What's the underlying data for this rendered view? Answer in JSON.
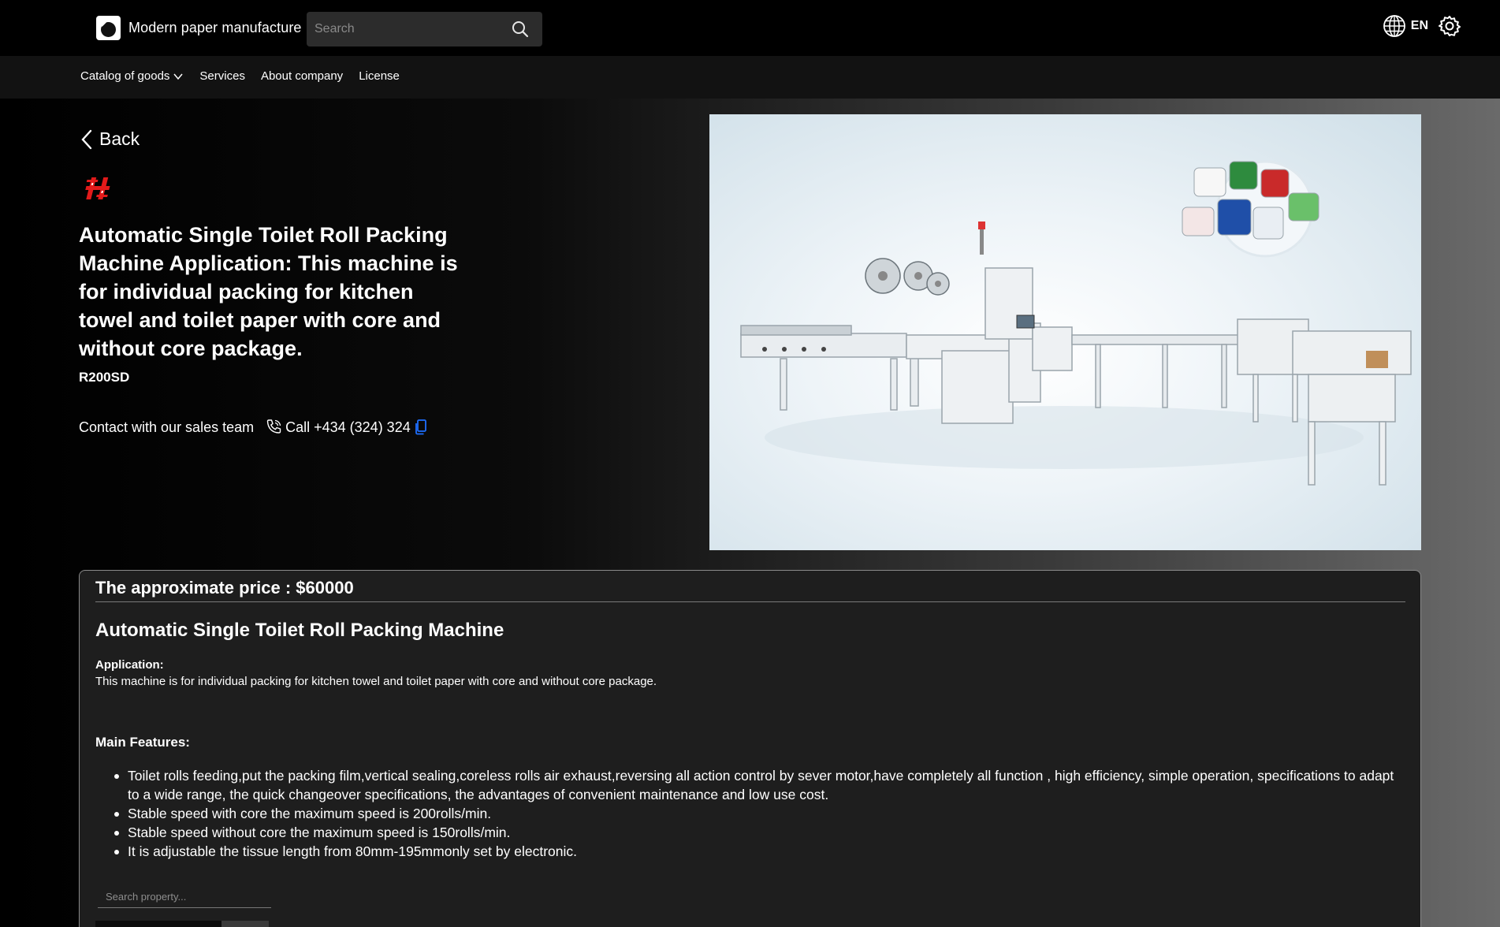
{
  "header": {
    "brand_name": "Modern paper manufacture",
    "search_placeholder": "Search",
    "language": "EN"
  },
  "nav": {
    "items": [
      {
        "label": "Catalog of goods",
        "has_dropdown": true
      },
      {
        "label": "Services"
      },
      {
        "label": "About company"
      },
      {
        "label": "License"
      }
    ]
  },
  "product": {
    "back_label": "Back",
    "title": "Automatic Single Toilet Roll Packing Machine Application: This machine is for individual packing for kitchen towel and toilet paper with core and without core package.",
    "sku": "R200SD",
    "contact_label": "Contact with our sales team",
    "call_label": "Call +434 (324) 324"
  },
  "details": {
    "price_label": "The approximate price : $60000",
    "spec_title": "Automatic Single Toilet Roll Packing Machine",
    "application_label": "Application:",
    "application_text": "This machine is for individual packing for kitchen towel and toilet paper with core and without core package.",
    "features_label": "Main Features:",
    "features": [
      "Toilet rolls feeding,put the packing film,vertical sealing,coreless rolls air exhaust,reversing all action control by sever motor,have completely all function , high efficiency, simple operation, specifications to adapt to a wide range, the quick changeover specifications, the advantages of convenient maintenance and low use cost.",
      "Stable speed with core the maximum speed is 200rolls/min.",
      "Stable speed without core the maximum speed is 150rolls/min.",
      "It is adjustable the tissue length from 80mm-195mmonly set by electronic."
    ],
    "property_search_placeholder": "Search property..."
  },
  "colors": {
    "accent_blue": "#1e6fff",
    "brand_red": "#e21a1a",
    "card_bg": "#1e1e1e"
  },
  "icons": [
    "brand-logo-icon",
    "search-icon",
    "globe-icon",
    "gear-icon",
    "chevron-down-icon",
    "chevron-left-icon",
    "phone-icon",
    "copy-icon",
    "brand-mark-icon"
  ]
}
